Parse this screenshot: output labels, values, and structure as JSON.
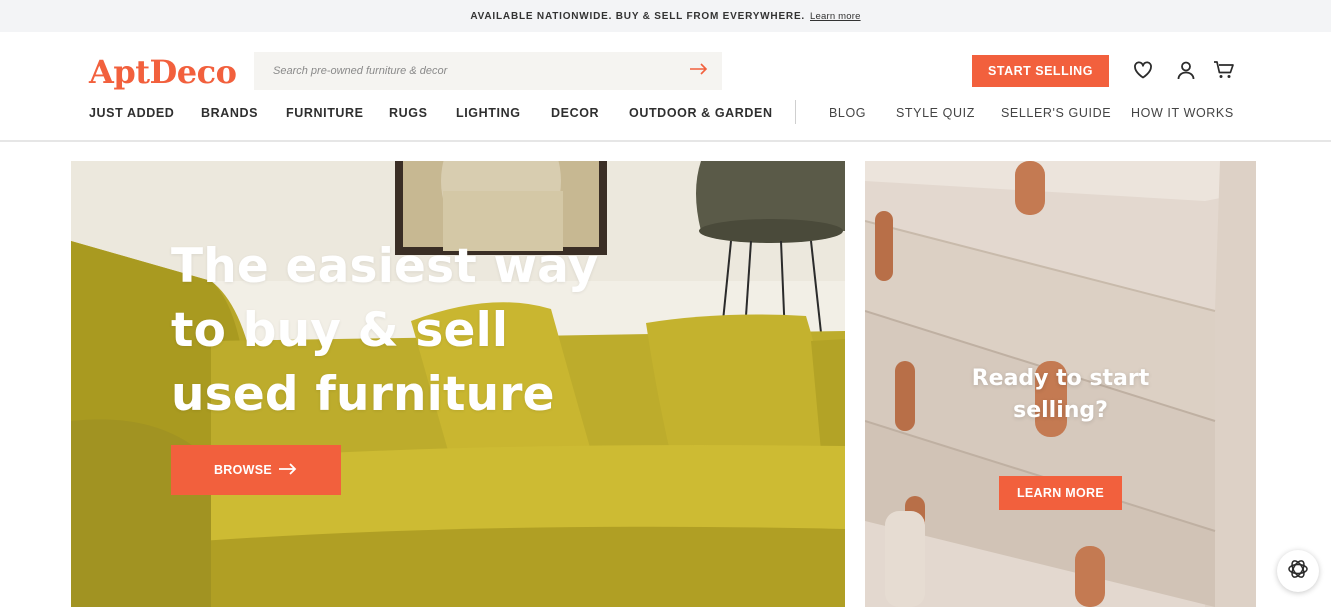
{
  "announcement": {
    "text": "AVAILABLE NATIONWIDE. BUY & SELL FROM EVERYWHERE.",
    "link_label": "Learn more"
  },
  "header": {
    "logo": "AptDeco",
    "search_placeholder": "Search pre-owned furniture & decor",
    "start_selling_label": "START SELLING",
    "icons": [
      "heart-icon",
      "user-icon",
      "cart-icon",
      "arrow-right-icon"
    ]
  },
  "nav": {
    "main": [
      "JUST ADDED",
      "BRANDS",
      "FURNITURE",
      "RUGS",
      "LIGHTING",
      "DECOR",
      "OUTDOOR & GARDEN"
    ],
    "secondary": [
      "BLOG",
      "STYLE QUIZ",
      "SELLER'S GUIDE",
      "HOW IT WORKS"
    ]
  },
  "hero": {
    "title_lines": [
      "The easiest way",
      "to buy & sell",
      "used furniture"
    ],
    "browse_label": "BROWSE"
  },
  "side_promo": {
    "title_lines": [
      "Ready to start",
      "selling?"
    ],
    "learn_more_label": "LEARN MORE"
  },
  "colors": {
    "accent": "#f2603d",
    "announcement_bg": "#f3f4f6",
    "search_bg": "#f5f4f1",
    "sofa": "#b5a423"
  }
}
